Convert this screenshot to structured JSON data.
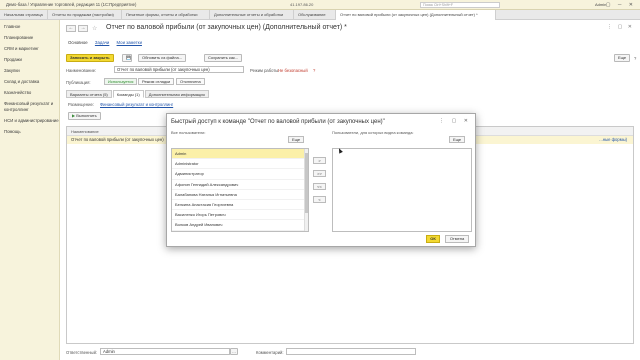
{
  "titlebar": {
    "app_title": "Демо-база / Управление торговлей, редакция 11  (1С:Предприятие)",
    "center": "41.197.86.20",
    "search_placeholder": "Поиск Ctrl+Shift+F",
    "user": "Admin",
    "winbtns": "▢ ─ ✕"
  },
  "tabs": [
    {
      "label": "Начальная страница"
    },
    {
      "label": "Отчеты по продажам (настройки)"
    },
    {
      "label": "Печатные формы, отчеты и обработки"
    },
    {
      "label": "Дополнительные отчеты и обработки"
    },
    {
      "label": "Обслуживание"
    },
    {
      "label": "Отчет по валовой прибыли (от закупочных цен) (Дополнительный отчет) *"
    }
  ],
  "sidebar": {
    "items": [
      {
        "label": "Главное"
      },
      {
        "label": "Планирование"
      },
      {
        "label": "CRM и маркетинг"
      },
      {
        "label": "Продажи"
      },
      {
        "label": "Закупки"
      },
      {
        "label": "Склад и доставка"
      },
      {
        "label": "Казначейство"
      },
      {
        "label": "Финансовый результат и контроллинг"
      },
      {
        "label": "НСИ и администрирование"
      },
      {
        "label": "Помощь"
      }
    ]
  },
  "form": {
    "back": "←",
    "forward": "→",
    "star": "☆",
    "title": "Отчет по валовой прибыли (от закупочных цен) (Дополнительный отчет) *",
    "controls": "⋮ ▢ ✕",
    "subnav": {
      "main": "Основное",
      "tasks": "Задачи",
      "notes": "Мои заметки"
    },
    "toolbar": {
      "save_close": "Записать и закрыть",
      "save_icon": "💾",
      "update_from_file": "Обновить из файла...",
      "save_as": "Сохранить как...",
      "more": "Еще",
      "help": "?"
    },
    "name_label": "Наименование:",
    "name_value": "Отчет по валовой прибыли (от закупочных цен)",
    "mode_label": "Режим работы:",
    "mode_value": "Не безопасный",
    "mode_q": "?",
    "pub_label": "Публикация:",
    "pub_options": {
      "used": "Используется",
      "debug": "Режим отладки",
      "disabled": "Отключена"
    },
    "subtabs": [
      {
        "label": "Варианты отчета (5)"
      },
      {
        "label": "Команды (1)"
      },
      {
        "label": "Дополнительная информация"
      }
    ],
    "placement_label": "Размещение:",
    "placement_value": "Финансовый результат и контроллинг",
    "execute": "Выполнить",
    "table_header": "Наименование",
    "table_row": "Отчет по валовой прибыли (от закупочных цен)",
    "table_row_tail": "...ные формы)",
    "responsible_label": "Ответственный:",
    "responsible_value": "Admin",
    "comment_label": "Комментарий:"
  },
  "modal": {
    "title": "Быстрый доступ к команде \"Отчет по валовой прибыли (от закупочных цен)\"",
    "controls": "⋮ ▢ ✕",
    "left_label": "Все пользователи:",
    "right_label": "Пользователи, для которых видна команда:",
    "more_left": "Еще",
    "more_right": "Еще",
    "users": [
      "Admin",
      "Administrator",
      "Администратор",
      "Афонин Геннадий Александрович",
      "Балабанова Наталья Игнатьевна",
      "Белкина Анастасия Георгиевна",
      "Василенко Игорь Петрович",
      "Волков Андрей Иванович"
    ],
    "arrows": {
      "add": ">",
      "add_all": ">>",
      "remove_all": "<<",
      "remove": "<"
    },
    "ok": "ОК",
    "cancel": "Отмена"
  },
  "colors": {
    "accent": "#f3d931",
    "sidebar_bg": "#f7f3dc",
    "selection": "#fbf0a8",
    "link": "#2255aa"
  }
}
